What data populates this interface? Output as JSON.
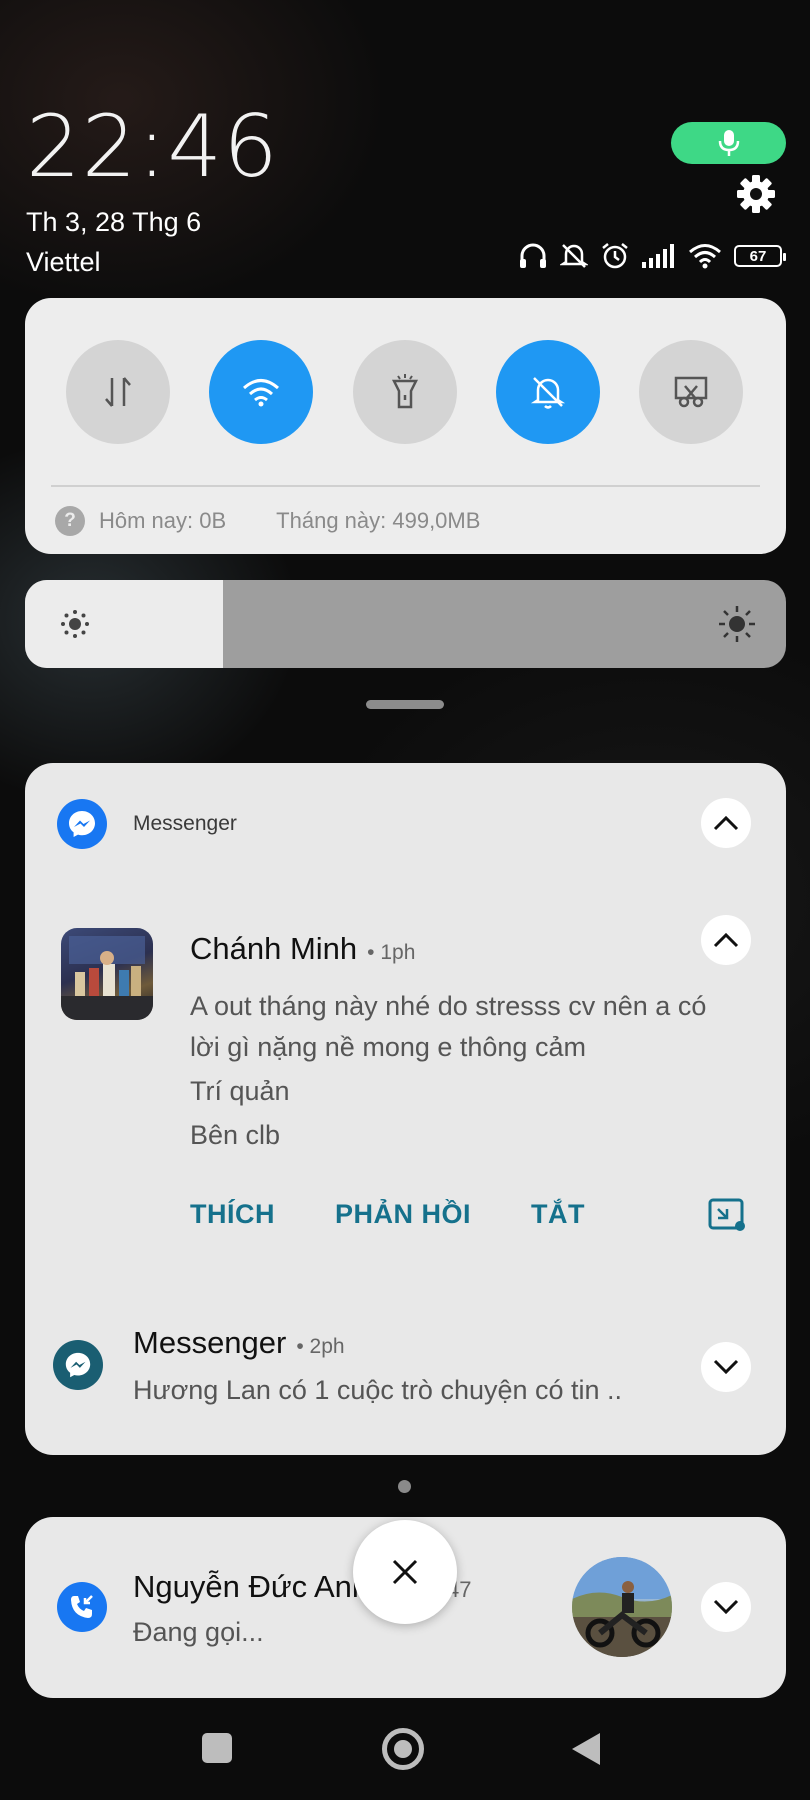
{
  "status_bar": {
    "time": "22:46",
    "date": "Th 3, 28 Thg 6",
    "carrier": "Viettel",
    "battery": "67",
    "mic_pill_color": "#3ed886",
    "icons": [
      "headphones-icon",
      "bell-off-icon",
      "alarm-icon",
      "signal-icon",
      "wifi-icon",
      "battery-icon"
    ]
  },
  "quick_settings": {
    "toggles": [
      {
        "name": "mobile-data",
        "icon": "data-arrows-icon",
        "state": "off"
      },
      {
        "name": "wifi",
        "icon": "wifi-icon",
        "state": "on"
      },
      {
        "name": "flashlight",
        "icon": "flashlight-icon",
        "state": "off"
      },
      {
        "name": "silent",
        "icon": "bell-off-icon",
        "state": "on"
      },
      {
        "name": "screenshot",
        "icon": "scissors-icon",
        "state": "off"
      }
    ],
    "usage_today": "Hôm nay: 0B",
    "usage_month": "Tháng này: 499,0MB",
    "accent_color": "#1f98f3"
  },
  "brightness": {
    "level": 0.26
  },
  "notification": {
    "app_name": "Messenger",
    "sender": "Chánh Minh",
    "time": "• 1ph",
    "lines": [
      "A out tháng này nhé do stresss cv nên a có",
      "lời gì nặng nề mong e thông cảm",
      "Trí quản",
      "Bên clb"
    ],
    "actions": [
      "THÍCH",
      "PHẢN HỒI",
      "TẮT"
    ],
    "action_color": "#15718c",
    "group": {
      "title": "Messenger",
      "time": "• 2ph",
      "text": "Hương Lan có 1 cuộc trò chuyện có tin .."
    }
  },
  "call": {
    "caller": "Nguyễn Đức Anh",
    "time_fragment": "47",
    "status": "Đang gọi..."
  },
  "nav": {
    "buttons": [
      "recents",
      "home",
      "back"
    ]
  }
}
